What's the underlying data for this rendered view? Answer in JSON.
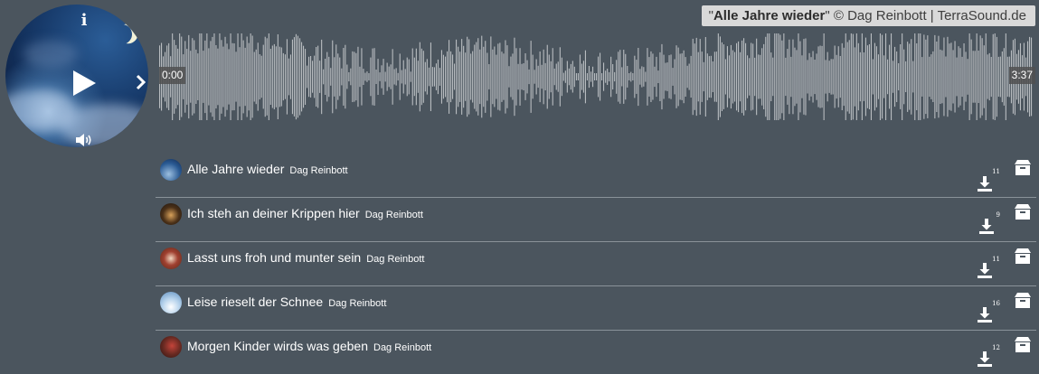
{
  "player": {
    "info_icon": "info-icon",
    "play_icon": "play-icon",
    "next_icon": "chevron-right-icon",
    "volume_icon": "volume-icon",
    "now_playing": {
      "title": "Alle Jahre wieder",
      "suffix": "\" © Dag Reinbott | TerraSound.de",
      "prefix": "\""
    },
    "time_current": "0:00",
    "time_total": "3:37"
  },
  "tracks": [
    {
      "title": "Alle Jahre wieder",
      "artist": "Dag Reinbott",
      "downloads": "11"
    },
    {
      "title": "Ich steh an deiner Krippen hier",
      "artist": "Dag Reinbott",
      "downloads": "9"
    },
    {
      "title": "Lasst uns froh und munter sein",
      "artist": "Dag Reinbott",
      "downloads": "11"
    },
    {
      "title": "Leise rieselt der Schnee",
      "artist": "Dag Reinbott",
      "downloads": "16"
    },
    {
      "title": "Morgen Kinder wirds was geben",
      "artist": "Dag Reinbott",
      "downloads": "12"
    }
  ],
  "colors": {
    "background": "#4b555e",
    "waveform": "#b8bcc0",
    "banner": "#d9d9d9"
  }
}
